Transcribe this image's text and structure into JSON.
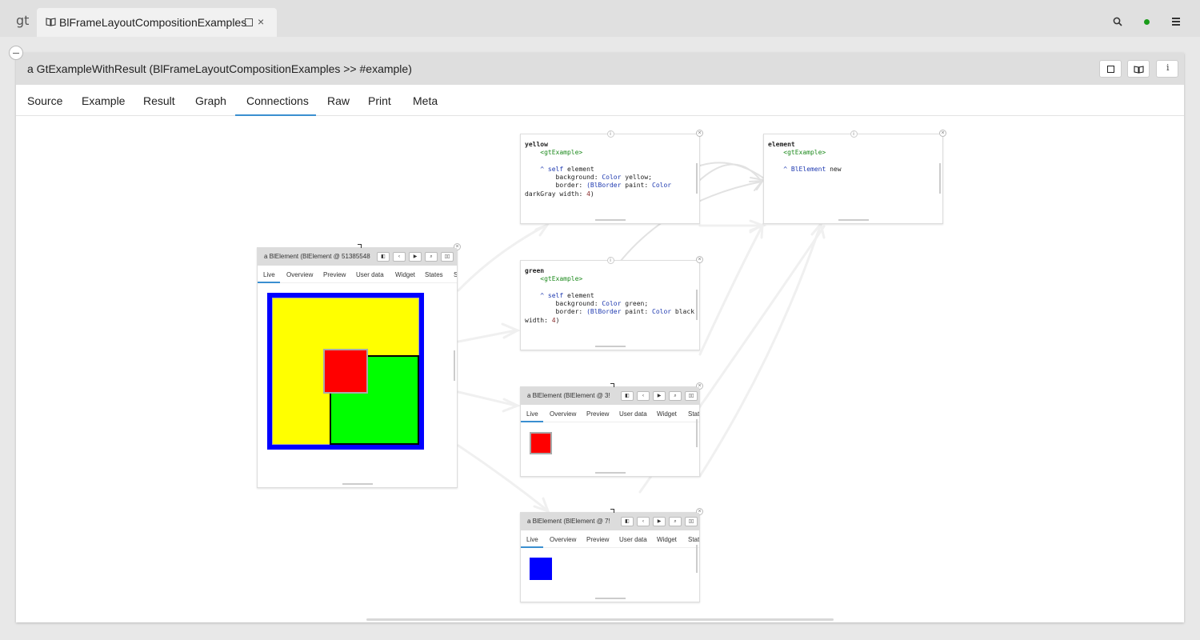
{
  "app": {
    "logo": "gt",
    "tab_title": "BlFrameLayoutCompositionExamples",
    "tab_close": "×"
  },
  "panel": {
    "title": "a GtExampleWithResult (BlFrameLayoutCompositionExamples >> #example)",
    "info_glyph": "i",
    "tabs": [
      "Source",
      "Example",
      "Result",
      "Graph",
      "Connections",
      "Raw",
      "Print",
      "Meta"
    ],
    "active_tab": "Connections"
  },
  "inspector_tabs": [
    "Live",
    "Overview",
    "Preview",
    "User data",
    "Widget",
    "States",
    "S"
  ],
  "inspector_main": {
    "title": "a BlElement (BlElement @ 51385548"
  },
  "inspector_red": {
    "title": "a BlElement (BlElement @ 3!"
  },
  "inspector_blue": {
    "title": "a BlElement (BlElement @ 7!"
  },
  "code_yellow": {
    "selector": "yellow",
    "pragma": "<gtExample>",
    "caret": "^",
    "self_kw": "self",
    "line1_rest": " element",
    "bg_kw": "background:",
    "color_cls": "Color",
    "yellow_sel": "yellow;",
    "border_kw": "border:",
    "blborder": "(BlBorder",
    "paint_kw": "paint:",
    "darkgray": "darkGray",
    "width_kw": "width:",
    "num": "4",
    "close": ")"
  },
  "code_green": {
    "selector": "green",
    "pragma": "<gtExample>",
    "caret": "^",
    "self_kw": "self",
    "line1_rest": " element",
    "bg_kw": "background:",
    "color_cls": "Color",
    "green_sel": "green;",
    "border_kw": "border:",
    "blborder": "(BlBorder",
    "paint_kw": "paint:",
    "black_sel": "black",
    "width_kw": "width:",
    "num": "4",
    "close": ")"
  },
  "code_element": {
    "selector": "element",
    "pragma": "<gtExample>",
    "caret": "^",
    "cls": "BlElement",
    "msg": "new"
  },
  "colors": {
    "accent": "#3a8fd0",
    "status": "#1a9c1a",
    "preview_blue": "#0000ff",
    "preview_yellow": "#ffff00",
    "preview_green": "#00ff00",
    "preview_red": "#ff0000"
  },
  "icons": [
    "book-icon",
    "maximize-icon",
    "close-icon",
    "search-icon",
    "status-dot",
    "menu-icon",
    "collapse-icon",
    "inspect-icon",
    "info-icon",
    "play-icon"
  ]
}
